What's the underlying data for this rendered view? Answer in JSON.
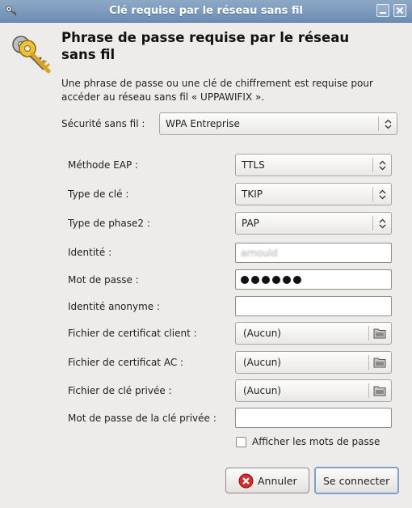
{
  "window": {
    "title": "Clé requise par le réseau sans fil",
    "icons": {
      "app": "key-icon",
      "minimize": "minimize-icon",
      "close": "close-icon"
    }
  },
  "header": {
    "icon": "keys-icon",
    "title": "Phrase de passe requise par le réseau sans fil",
    "description": "Une phrase de passe ou une clé de chiffrement est requise pour accéder au réseau sans fil « UPPAWIFIX »."
  },
  "security": {
    "label": "Sécurité sans fil :",
    "value": "WPA Entreprise"
  },
  "form": {
    "eap_method": {
      "label": "Méthode EAP :",
      "value": "TTLS"
    },
    "key_type": {
      "label": "Type de clé :",
      "value": "TKIP"
    },
    "phase2_type": {
      "label": "Type de phase2 :",
      "value": "PAP"
    },
    "identity": {
      "label": "Identité :",
      "value": "arnould"
    },
    "password": {
      "label": "Mot de passe :",
      "masked_length": 6
    },
    "anonymous_identity": {
      "label": "Identité anonyme :",
      "value": ""
    },
    "client_cert": {
      "label": "Fichier de certificat client :",
      "value": "(Aucun)",
      "icon": "folder-icon"
    },
    "ca_cert": {
      "label": "Fichier de certificat AC :",
      "value": "(Aucun)",
      "icon": "folder-icon"
    },
    "private_key": {
      "label": "Fichier de clé privée :",
      "value": "(Aucun)",
      "icon": "folder-icon"
    },
    "private_key_password": {
      "label": "Mot de passe de la clé privée :",
      "value": ""
    },
    "show_passwords": {
      "label": "Afficher les mots de passe",
      "checked": false
    }
  },
  "buttons": {
    "cancel": {
      "label": "Annuler",
      "icon": "cancel-icon"
    },
    "connect": {
      "label": "Se connecter"
    }
  },
  "colors": {
    "titlebar": "#7d9ac0",
    "window_bg": "#edeceb",
    "focus": "#7fa0c8"
  }
}
